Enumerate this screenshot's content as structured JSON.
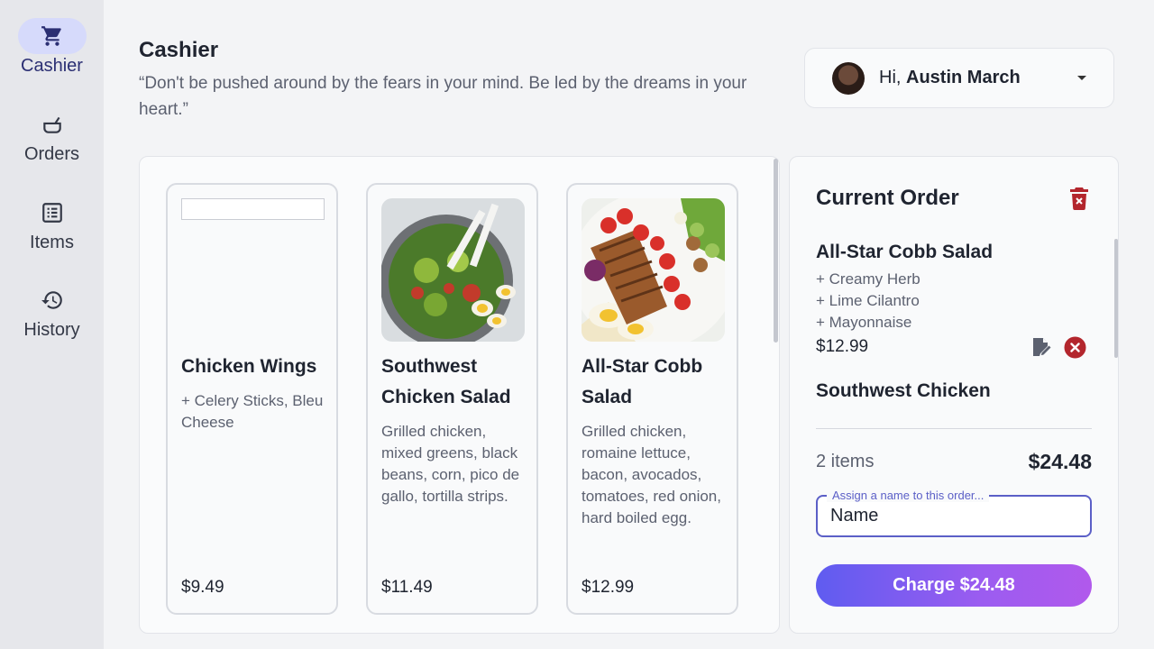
{
  "sidebar": {
    "items": [
      {
        "label": "Cashier",
        "icon": "cart-icon",
        "active": true
      },
      {
        "label": "Orders",
        "icon": "pot-icon",
        "active": false
      },
      {
        "label": "Items",
        "icon": "list-icon",
        "active": false
      },
      {
        "label": "History",
        "icon": "history-icon",
        "active": false
      }
    ]
  },
  "header": {
    "title": "Cashier",
    "quote": "“Don't be pushed around by the fears in your mind. Be led by the dreams in your heart.”",
    "greeting": "Hi,",
    "user_name": "Austin March"
  },
  "menu_items": [
    {
      "name": "Chicken Wings",
      "description": "+ Celery Sticks, Bleu Cheese",
      "price": "$9.49",
      "image": "broken-image"
    },
    {
      "name": "Southwest Chicken Salad",
      "description": "Grilled chicken, mixed greens, black beans, corn, pico de gallo, tortilla strips.",
      "price": "$11.49",
      "image": "salad-bowl-photo"
    },
    {
      "name": "All-Star Cobb Salad",
      "description": "Grilled chicken, romaine lettuce, bacon, avocados, tomatoes, red onion, hard boiled egg.",
      "price": "$12.99",
      "image": "cobb-salad-photo"
    }
  ],
  "order": {
    "title": "Current Order",
    "items": [
      {
        "name": "All-Star Cobb Salad",
        "modifiers": [
          "+ Creamy Herb",
          "+ Lime Cilantro",
          "+ Mayonnaise"
        ],
        "price": "$12.99"
      },
      {
        "name": "Southwest Chicken",
        "modifiers": [],
        "price": ""
      }
    ],
    "count_label": "2 items",
    "total": "$24.48",
    "name_field": {
      "legend": "Assign a name to this order...",
      "placeholder": "Name"
    },
    "charge_label": "Charge $24.48"
  },
  "colors": {
    "accent": "#5b5fc7",
    "danger": "#b3262d",
    "charge_gradient_start": "#5f5cf0",
    "charge_gradient_end": "#b159ec"
  }
}
